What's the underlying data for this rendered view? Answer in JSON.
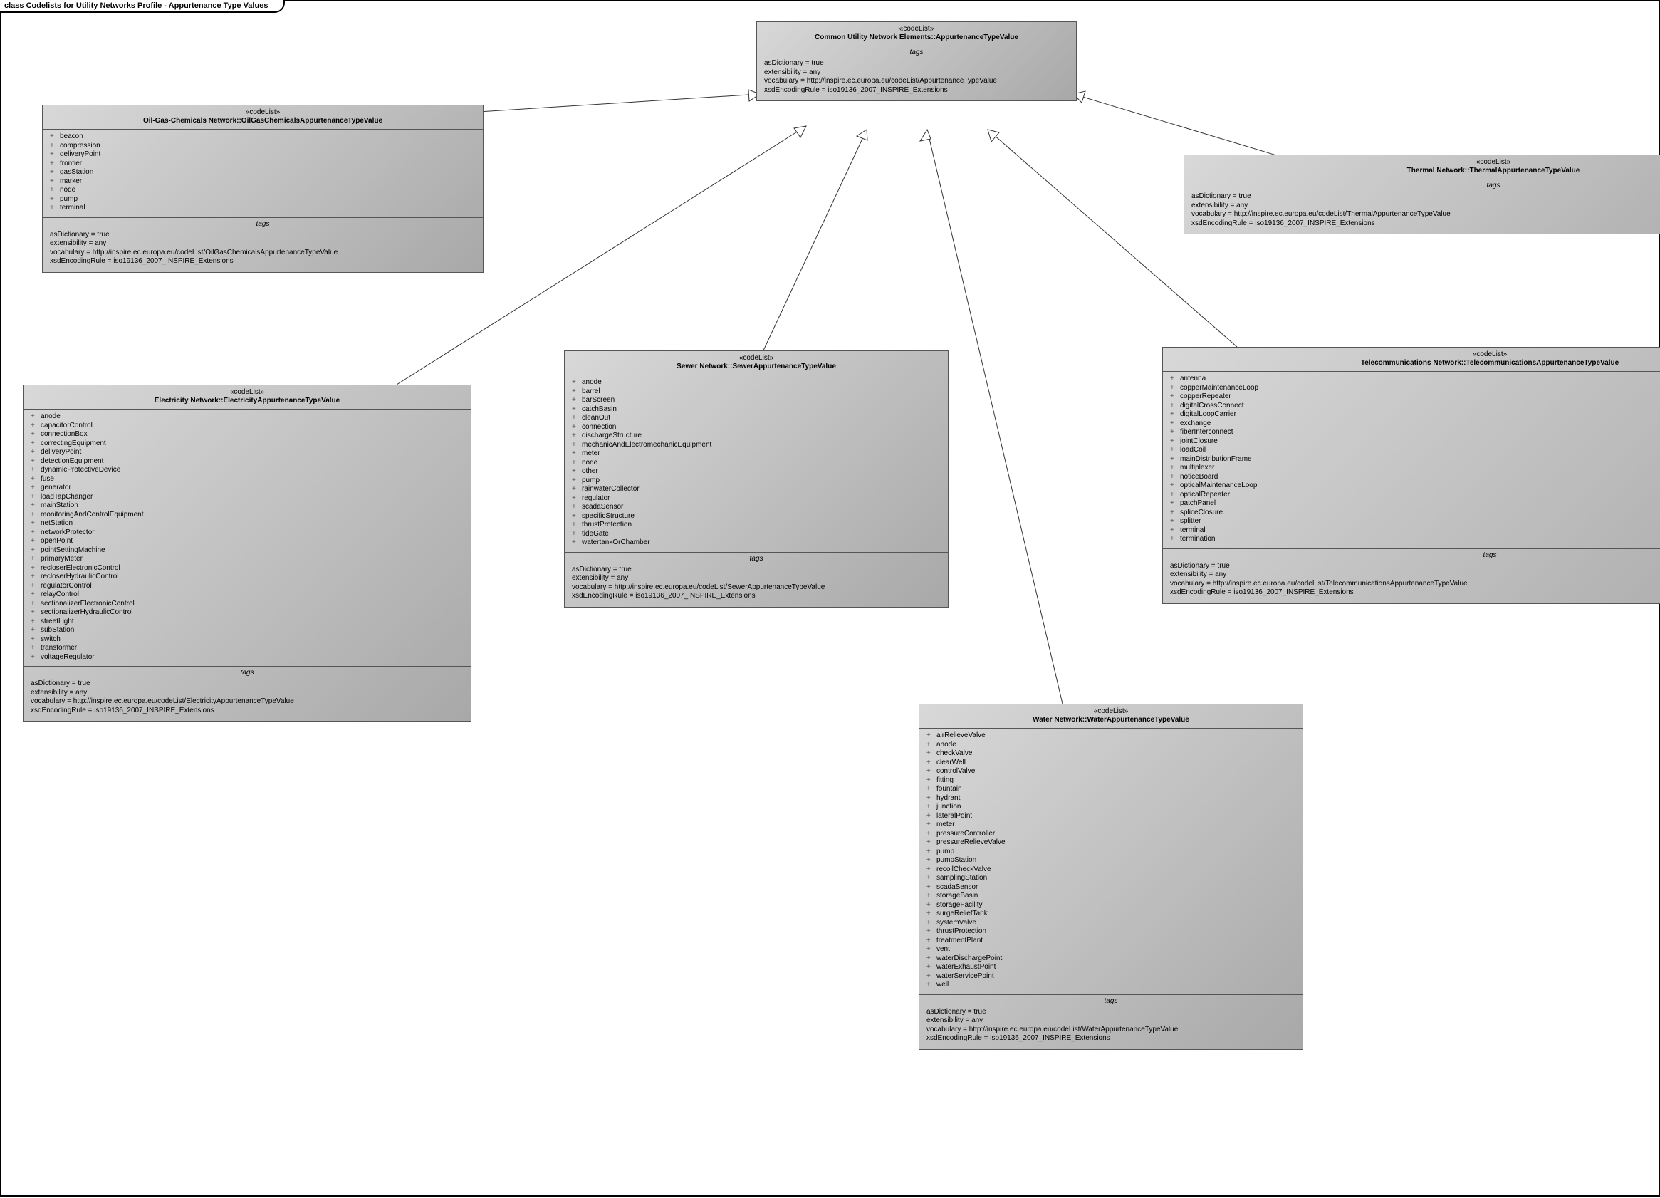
{
  "diagram_title": "class Codelists for Utility Networks Profile - Appurtenance Type Values",
  "stereotype": "«codeList»",
  "tags_label": "tags",
  "nodes": {
    "common": {
      "title": "Common Utility Network Elements::AppurtenanceTypeValue",
      "tags": {
        "asDictionary": "asDictionary = true",
        "extensibility": "extensibility = any",
        "vocabulary": "vocabulary = http://inspire.ec.europa.eu/codeList/AppurtenanceTypeValue",
        "xsd": "xsdEncodingRule = iso19136_2007_INSPIRE_Extensions"
      }
    },
    "ogc": {
      "title": "Oil-Gas-Chemicals Network::OilGasChemicalsAppurtenanceTypeValue",
      "attrs": [
        "beacon",
        "compression",
        "deliveryPoint",
        "frontier",
        "gasStation",
        "marker",
        "node",
        "pump",
        "terminal"
      ],
      "tags": {
        "asDictionary": "asDictionary = true",
        "extensibility": "extensibility = any",
        "vocabulary": "vocabulary = http://inspire.ec.europa.eu/codeList/OilGasChemicalsAppurtenanceTypeValue",
        "xsd": "xsdEncodingRule = iso19136_2007_INSPIRE_Extensions"
      }
    },
    "thermal": {
      "title": "Thermal Network::ThermalAppurtenanceTypeValue",
      "tags": {
        "asDictionary": "asDictionary = true",
        "extensibility": "extensibility = any",
        "vocabulary": "vocabulary = http://inspire.ec.europa.eu/codeList/ThermalAppurtenanceTypeValue",
        "xsd": "xsdEncodingRule = iso19136_2007_INSPIRE_Extensions"
      }
    },
    "electricity": {
      "title": "Electricity Network::ElectricityAppurtenanceTypeValue",
      "attrs": [
        "anode",
        "capacitorControl",
        "connectionBox",
        "correctingEquipment",
        "deliveryPoint",
        "detectionEquipment",
        "dynamicProtectiveDevice",
        "fuse",
        "generator",
        "loadTapChanger",
        "mainStation",
        "monitoringAndControlEquipment",
        "netStation",
        "networkProtector",
        "openPoint",
        "pointSettingMachine",
        "primaryMeter",
        "recloserElectronicControl",
        "recloserHydraulicControl",
        "regulatorControl",
        "relayControl",
        "sectionalizerElectronicControl",
        "sectionalizerHydraulicControl",
        "streetLight",
        "subStation",
        "switch",
        "transformer",
        "voltageRegulator"
      ],
      "tags": {
        "asDictionary": "asDictionary = true",
        "extensibility": "extensibility = any",
        "vocabulary": "vocabulary = http://inspire.ec.europa.eu/codeList/ElectricityAppurtenanceTypeValue",
        "xsd": "xsdEncodingRule = iso19136_2007_INSPIRE_Extensions"
      }
    },
    "sewer": {
      "title": "Sewer Network::SewerAppurtenanceTypeValue",
      "attrs": [
        "anode",
        "barrel",
        "barScreen",
        "catchBasin",
        "cleanOut",
        "connection",
        "dischargeStructure",
        "mechanicAndElectromechanicEquipment",
        "meter",
        "node",
        "other",
        "pump",
        "rainwaterCollector",
        "regulator",
        "scadaSensor",
        "specificStructure",
        "thrustProtection",
        "tideGate",
        "watertankOrChamber"
      ],
      "tags": {
        "asDictionary": "asDictionary = true",
        "extensibility": "extensibility = any",
        "vocabulary": "vocabulary = http://inspire.ec.europa.eu/codeList/SewerAppurtenanceTypeValue",
        "xsd": "xsdEncodingRule = iso19136_2007_INSPIRE_Extensions"
      }
    },
    "telecom": {
      "title": "Telecommunications Network::TelecommunicationsAppurtenanceTypeValue",
      "attrs": [
        "antenna",
        "copperMaintenanceLoop",
        "copperRepeater",
        "digitalCrossConnect",
        "digitalLoopCarrier",
        "exchange",
        "fiberInterconnect",
        "jointClosure",
        "loadCoil",
        "mainDistributionFrame",
        "multiplexer",
        "noticeBoard",
        "opticalMaintenanceLoop",
        "opticalRepeater",
        "patchPanel",
        "spliceClosure",
        "splitter",
        "terminal",
        "termination"
      ],
      "tags": {
        "asDictionary": "asDictionary = true",
        "extensibility": "extensibility = any",
        "vocabulary": "vocabulary = http://inspire.ec.europa.eu/codeList/TelecommunicationsAppurtenanceTypeValue",
        "xsd": "xsdEncodingRule = iso19136_2007_INSPIRE_Extensions"
      }
    },
    "water": {
      "title": "Water Network::WaterAppurtenanceTypeValue",
      "attrs": [
        "airRelieveValve",
        "anode",
        "checkValve",
        "clearWell",
        "controlValve",
        "fitting",
        "fountain",
        "hydrant",
        "junction",
        "lateralPoint",
        "meter",
        "pressureController",
        "pressureRelieveValve",
        "pump",
        "pumpStation",
        "recoilCheckValve",
        "samplingStation",
        "scadaSensor",
        "storageBasin",
        "storageFacility",
        "surgeReliefTank",
        "systemValve",
        "thrustProtection",
        "treatmentPlant",
        "vent",
        "waterDischargePoint",
        "waterExhaustPoint",
        "waterServicePoint",
        "well"
      ],
      "tags": {
        "asDictionary": "asDictionary = true",
        "extensibility": "extensibility = any",
        "vocabulary": "vocabulary = http://inspire.ec.europa.eu/codeList/WaterAppurtenanceTypeValue",
        "xsd": "xsdEncodingRule = iso19136_2007_INSPIRE_Extensions"
      }
    }
  }
}
